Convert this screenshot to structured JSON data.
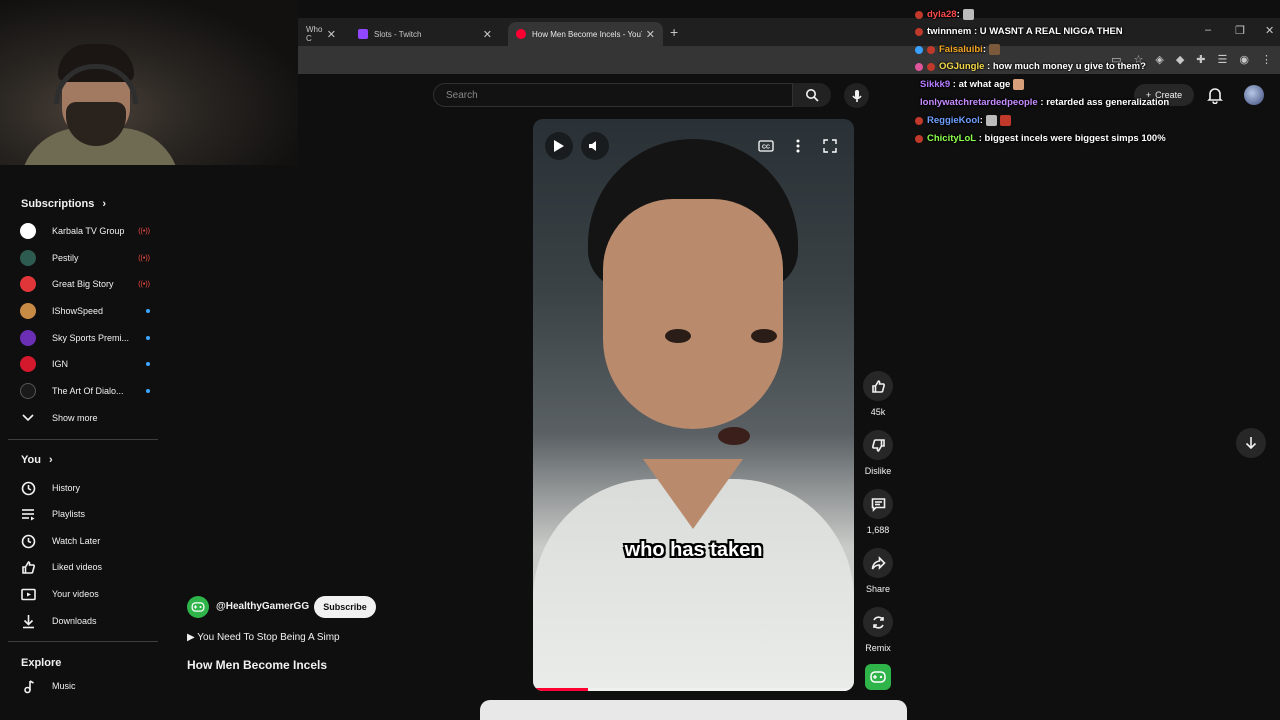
{
  "browser": {
    "tabs": [
      {
        "label": "Who C",
        "active": false
      },
      {
        "label": "Slots - Twitch",
        "active": false
      },
      {
        "label": "How Men Become Incels - YouTube",
        "active": true
      }
    ],
    "new_tab": "+",
    "window_controls": [
      "–",
      "❐",
      "✕"
    ]
  },
  "search": {
    "placeholder": "Search"
  },
  "header": {
    "create_label": "Create"
  },
  "sidebar": {
    "subscriptions_title": "Subscriptions",
    "subscriptions": [
      {
        "name": "Karbala TV Group",
        "status": "live",
        "color": "#ffffff"
      },
      {
        "name": "Pestily",
        "status": "live",
        "color": "#2d5b4f"
      },
      {
        "name": "Great Big Story",
        "status": "live",
        "color": "#e0363a"
      },
      {
        "name": "IShowSpeed",
        "status": "new",
        "color": "#c88b45"
      },
      {
        "name": "Sky Sports Premi...",
        "status": "new",
        "color": "#6b2fb6"
      },
      {
        "name": "IGN",
        "status": "new",
        "color": "#d3192b"
      },
      {
        "name": "The Art Of Dialo...",
        "status": "new",
        "color": "#1a1a1a"
      }
    ],
    "show_more": "Show more",
    "you_title": "You",
    "you_items": [
      {
        "label": "History",
        "icon": "history-icon"
      },
      {
        "label": "Playlists",
        "icon": "playlists-icon"
      },
      {
        "label": "Watch Later",
        "icon": "watch-later-icon"
      },
      {
        "label": "Liked videos",
        "icon": "liked-videos-icon"
      },
      {
        "label": "Your videos",
        "icon": "your-videos-icon"
      },
      {
        "label": "Downloads",
        "icon": "downloads-icon"
      }
    ],
    "explore_title": "Explore",
    "explore_items": [
      {
        "label": "Music",
        "icon": "music-icon"
      }
    ]
  },
  "video": {
    "caption": "who has taken",
    "progress": 0.17
  },
  "actions": {
    "likes": "45k",
    "dislike": "Dislike",
    "comments": "1,688",
    "share": "Share",
    "remix": "Remix"
  },
  "channel": {
    "handle": "@HealthyGamerGG",
    "subscribe": "Subscribe",
    "playlist": "▶  You Need To Stop Being A Simp",
    "title": "How Men Become Incels"
  },
  "chat": [
    {
      "user": "dyla28",
      "color": "#ff4b4b",
      "text": ""
    },
    {
      "user": "twinnnem",
      "color": "#ffffff",
      "text": "U WASNT A REAL NIGGA THEN"
    },
    {
      "user": "Faisaluibi",
      "color": "#f5a623",
      "text": ""
    },
    {
      "user": "OGJungle",
      "color": "#f5d94a",
      "text": "how much money u give to them?"
    },
    {
      "user": "Sikkk9",
      "color": "#b57bff",
      "text": "at what age"
    },
    {
      "user": "lonlywatchretardedpeople",
      "color": "#c58bff",
      "text": "retarded ass generalization"
    },
    {
      "user": "ReggieKool",
      "color": "#6ea0ff",
      "text": ""
    },
    {
      "user": "ChicityLoL",
      "color": "#8cff4b",
      "text": "biggest incels were biggest simps 100%"
    }
  ]
}
